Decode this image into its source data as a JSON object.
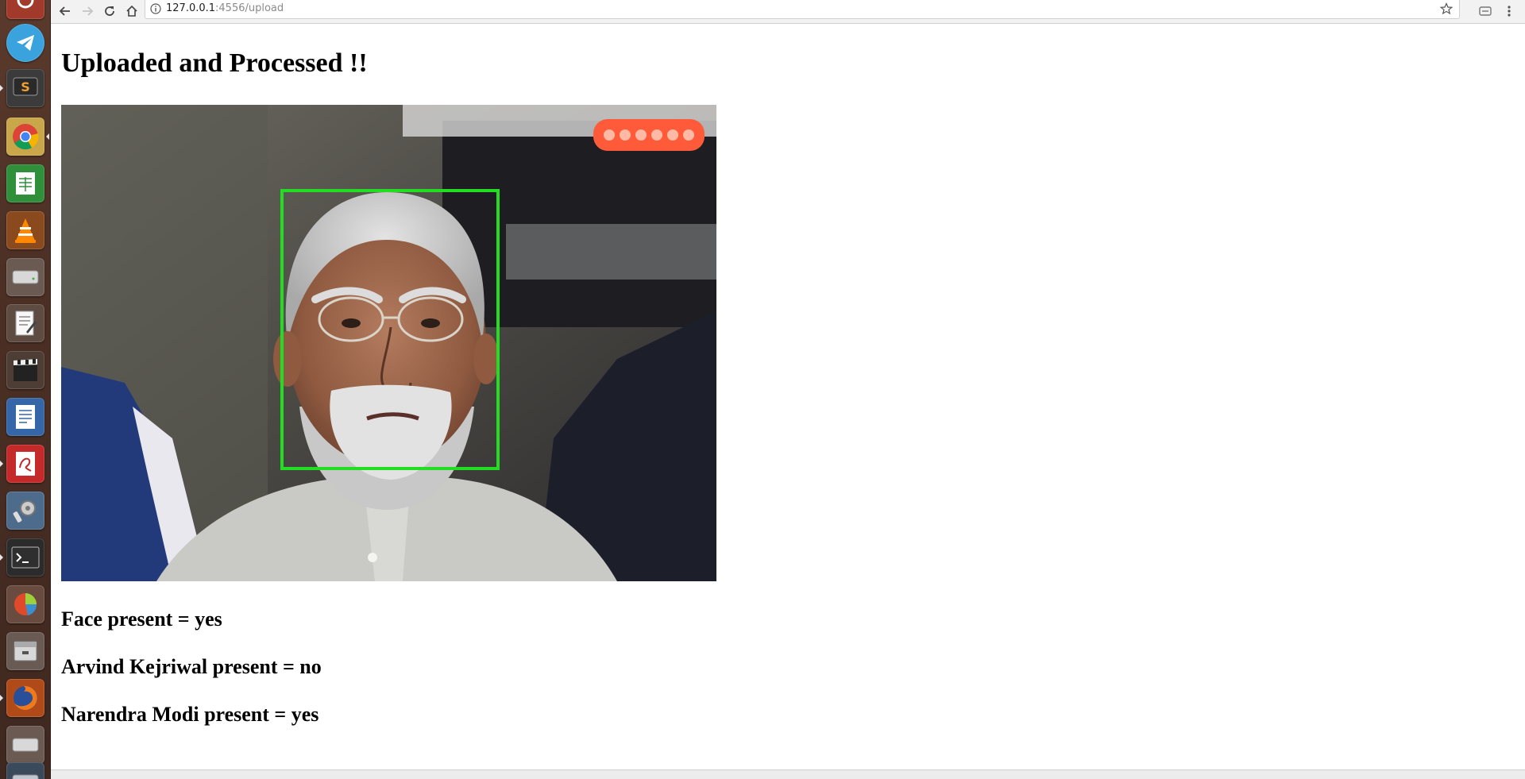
{
  "browser": {
    "url_host": "127.0.0.1",
    "url_rest": ":4556/upload"
  },
  "page": {
    "title": "Uploaded and Processed !!",
    "results": [
      "Face present = yes",
      "Arvind Kejriwal present = no",
      "Narendra Modi present = yes"
    ]
  },
  "image": {
    "description_icon": "face-photo",
    "detection_box_color": "#22dd22"
  },
  "launcher": {
    "items": [
      "ubuntu-icon",
      "telegram-icon",
      "sublime-text-icon",
      "chrome-icon",
      "spreadsheet-icon",
      "vlc-icon",
      "disk-icon",
      "text-editor-icon",
      "video-editor-icon",
      "writer-icon",
      "evince-icon",
      "settings-icon",
      "terminal-icon",
      "disk-usage-icon",
      "archive-icon",
      "firefox-icon",
      "drive-icon",
      "drive2-icon"
    ]
  }
}
